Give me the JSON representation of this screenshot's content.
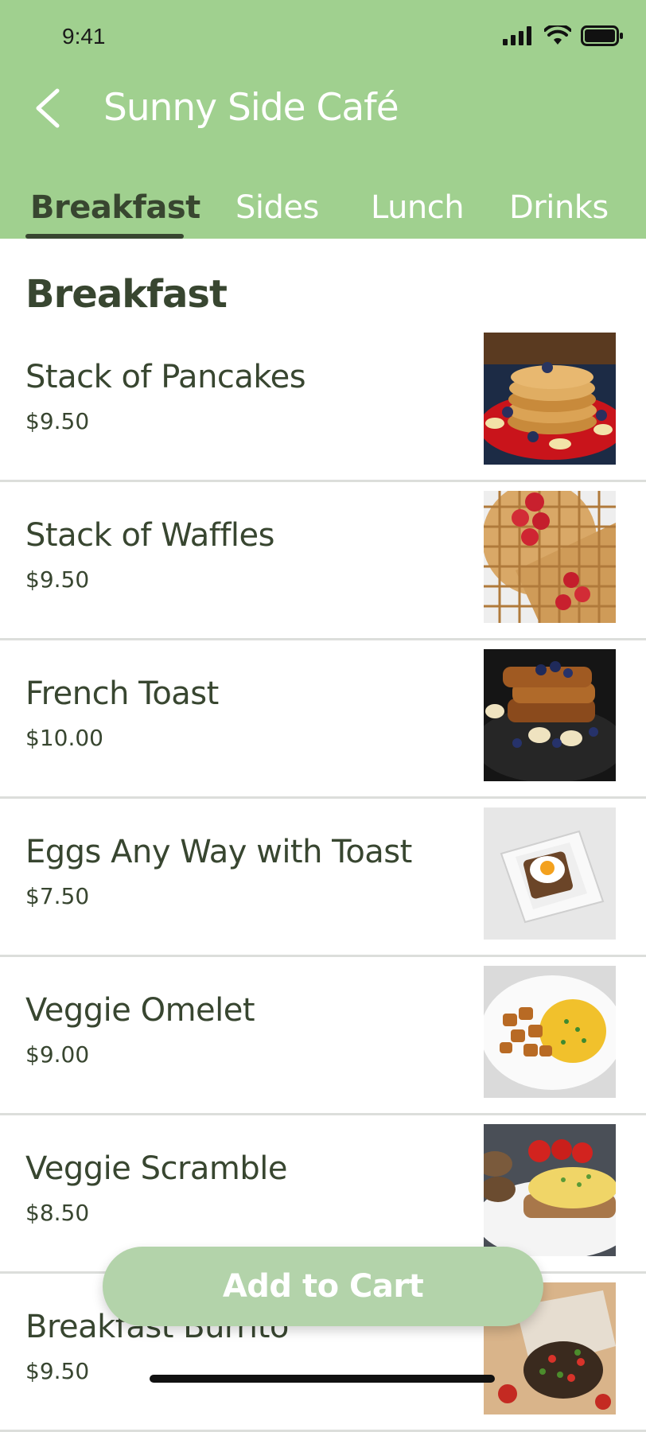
{
  "status": {
    "time": "9:41"
  },
  "header": {
    "title": "Sunny Side Café",
    "tabs": [
      {
        "label": "Breakfast",
        "active": true
      },
      {
        "label": "Sides"
      },
      {
        "label": "Lunch"
      },
      {
        "label": "Drinks"
      }
    ]
  },
  "section": {
    "title": "Breakfast"
  },
  "items": [
    {
      "name": "Stack of Pancakes",
      "price": "$9.50"
    },
    {
      "name": "Stack of Waffles",
      "price": "$9.50"
    },
    {
      "name": "French Toast",
      "price": "$10.00"
    },
    {
      "name": "Eggs Any Way with Toast",
      "price": "$7.50"
    },
    {
      "name": "Veggie Omelet",
      "price": "$9.00"
    },
    {
      "name": "Veggie Scramble",
      "price": "$8.50"
    },
    {
      "name": "Breakfast Burrito",
      "price": "$9.50"
    }
  ],
  "cart": {
    "label": "Add to Cart"
  },
  "colors": {
    "header": "#a0d08f",
    "text_dark": "#384630",
    "cart_button": "#b3d3aa"
  }
}
